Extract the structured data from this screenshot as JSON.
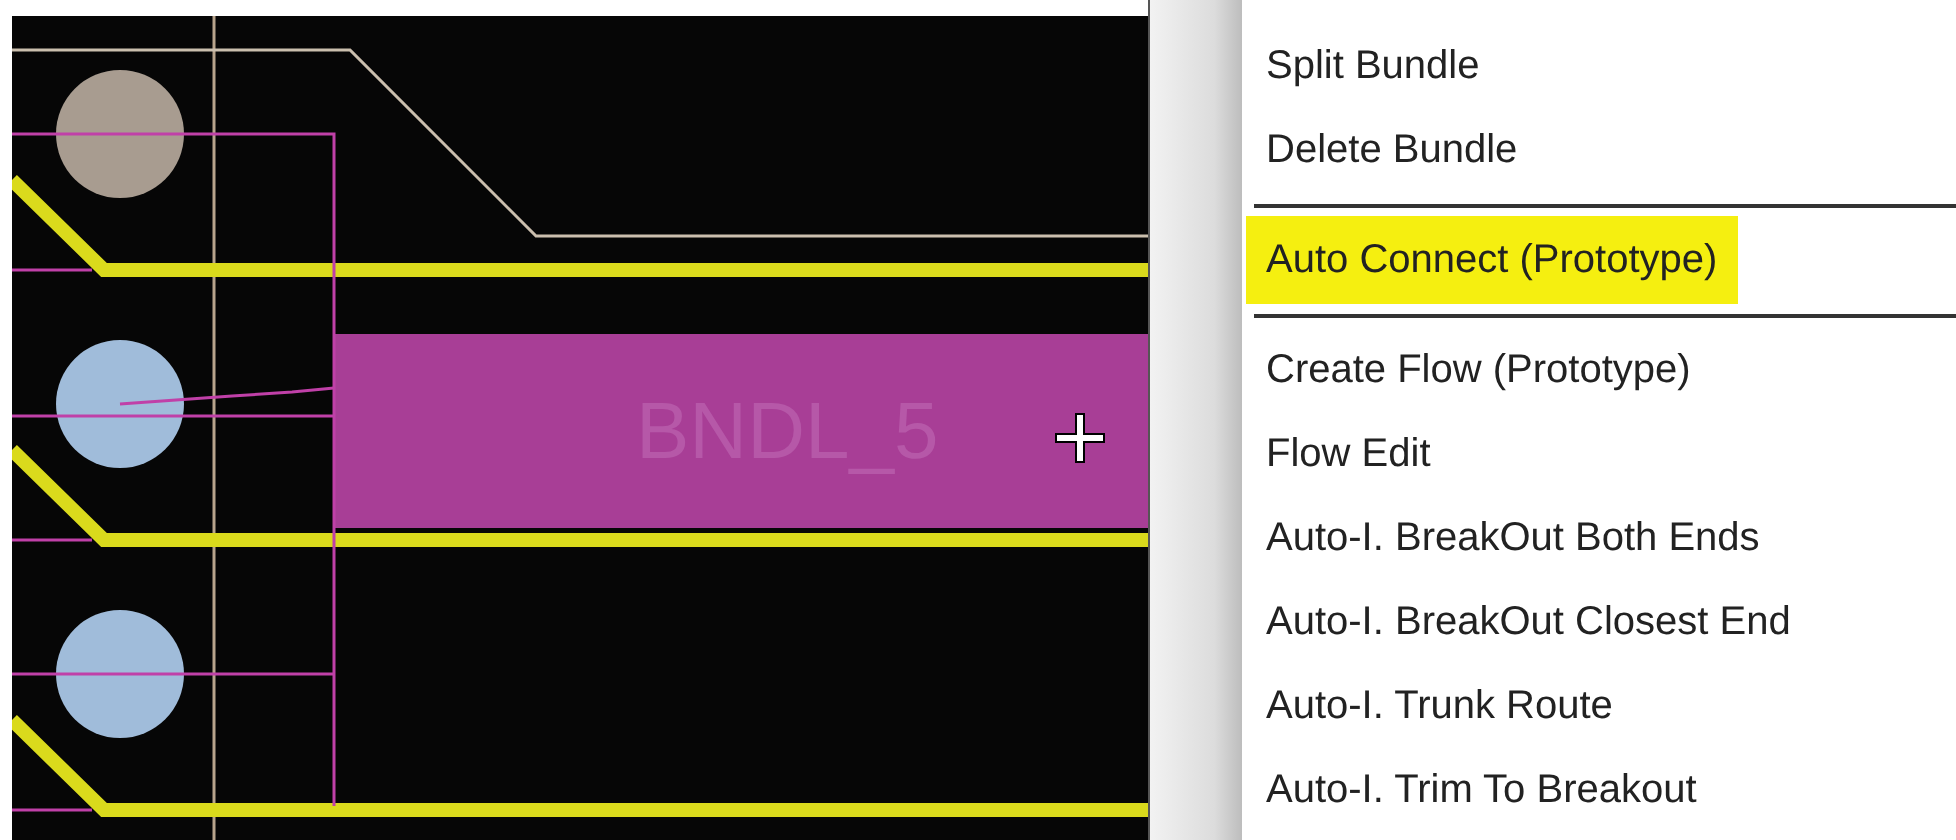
{
  "canvas": {
    "bundle_label": "BNDL_5"
  },
  "menu": {
    "items": [
      {
        "label": "Split Bundle",
        "highlighted": false,
        "separator_after": false
      },
      {
        "label": "Delete Bundle",
        "highlighted": false,
        "separator_after": true
      },
      {
        "label": "Auto Connect (Prototype)",
        "highlighted": true,
        "separator_after": true
      },
      {
        "label": "Create Flow (Prototype)",
        "highlighted": false,
        "separator_after": false
      },
      {
        "label": "Flow Edit",
        "highlighted": false,
        "separator_after": false
      },
      {
        "label": "Auto-I. BreakOut Both Ends",
        "highlighted": false,
        "separator_after": false
      },
      {
        "label": "Auto-I. BreakOut Closest End",
        "highlighted": false,
        "separator_after": false
      },
      {
        "label": "Auto-I. Trunk Route",
        "highlighted": false,
        "separator_after": false
      },
      {
        "label": "Auto-I. Trim To Breakout",
        "highlighted": false,
        "separator_after": false
      }
    ]
  }
}
